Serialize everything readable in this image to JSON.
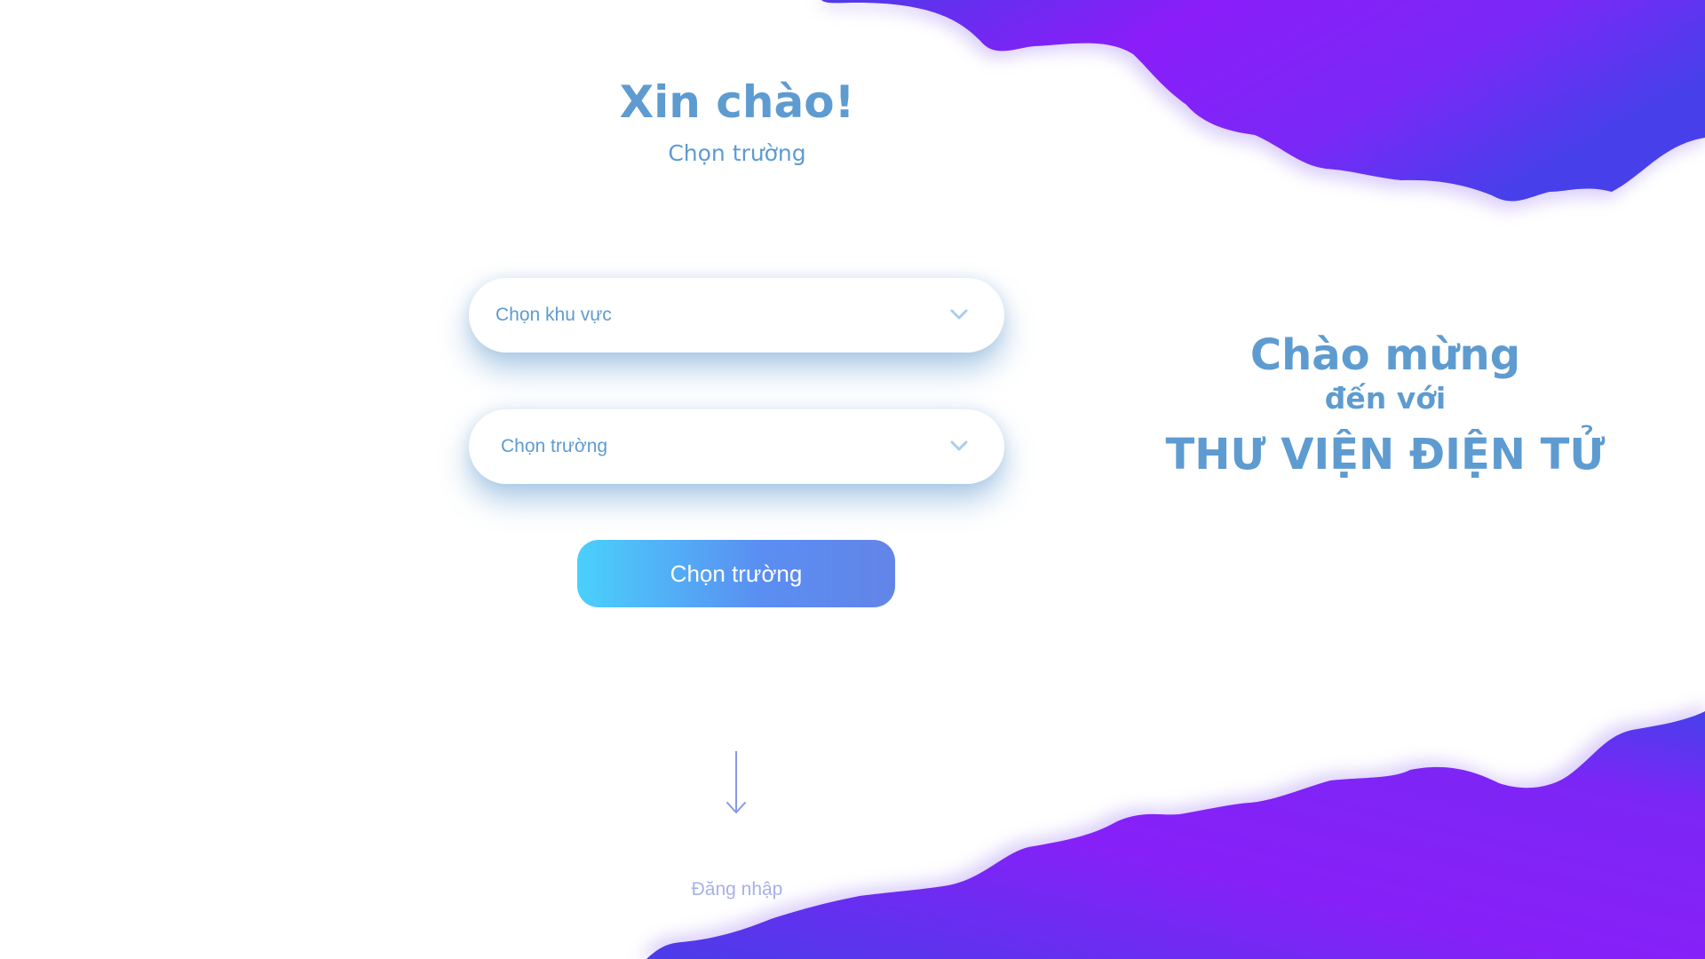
{
  "header": {
    "title": "Xin chào!",
    "subtitle": "Chọn trường"
  },
  "form": {
    "region_select": {
      "label": "Chọn khu vực",
      "icon": "chevron-down-icon"
    },
    "school_select": {
      "label": "Chọn trường",
      "icon": "chevron-down-icon"
    },
    "submit_button": "Chọn trường"
  },
  "footer": {
    "arrow_icon": "arrow-down-icon",
    "login_link": "Đăng nhập"
  },
  "welcome": {
    "line1": "Chào mừng",
    "line2": "đến với",
    "line3": "THƯ VIỆN ĐIỆN TỬ"
  },
  "colors": {
    "text_blue": "#5e9bd0",
    "button_gradient_start": "#4ad0fc",
    "button_gradient_end": "#6384e8",
    "wave_purple": "#8a1df9",
    "wave_blue": "#4740ea",
    "login_link": "#a8b0e8"
  }
}
